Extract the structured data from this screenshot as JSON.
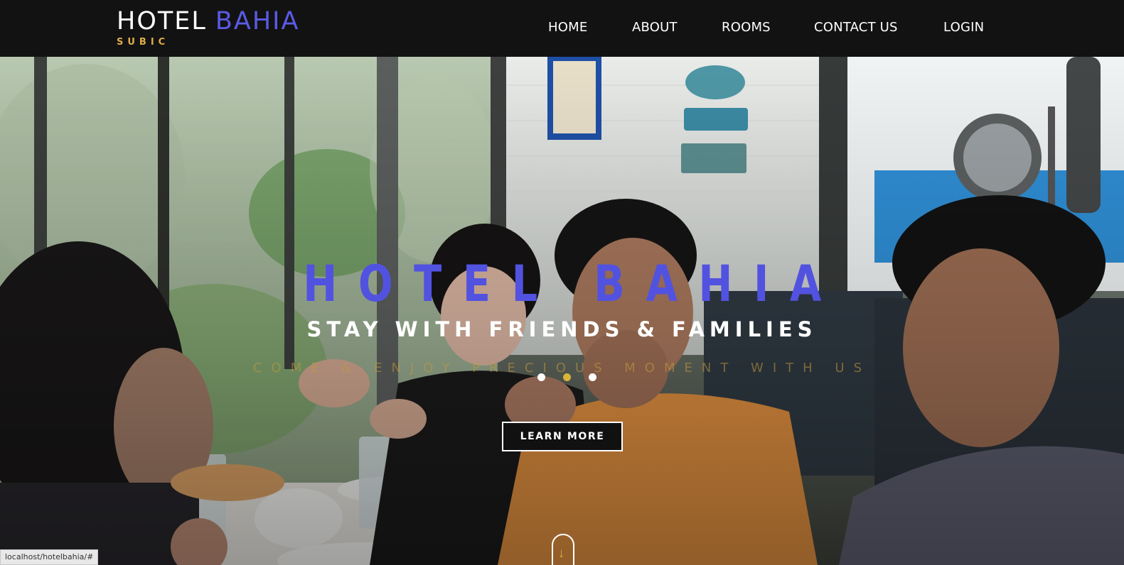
{
  "brand": {
    "word1": "HOTEL",
    "word2": "BAHIA",
    "subtitle": "SUBIC"
  },
  "nav": [
    {
      "label": "HOME"
    },
    {
      "label": "ABOUT"
    },
    {
      "label": "ROOMS"
    },
    {
      "label": "CONTACT US"
    },
    {
      "label": "LOGIN"
    }
  ],
  "hero": {
    "title": "HOTEL BAHIA",
    "subtitle": "STAY WITH FRIENDS & FAMILIES",
    "tagline": "COME & ENJOY PRECIOUS MOMENT WITH US",
    "button": "LEARN MORE",
    "slide_count": 3,
    "active_slide": 2,
    "scroll_icon": "arrow-down-icon"
  },
  "status_bar": {
    "url": "localhost/hotelbahia/#"
  },
  "colors": {
    "header_bg": "#121212",
    "brand_accent": "#5a5ae6",
    "subtitle_gold": "#e0ad4a",
    "title_blue": "#5252e0",
    "dot_active": "#d8b43a"
  }
}
